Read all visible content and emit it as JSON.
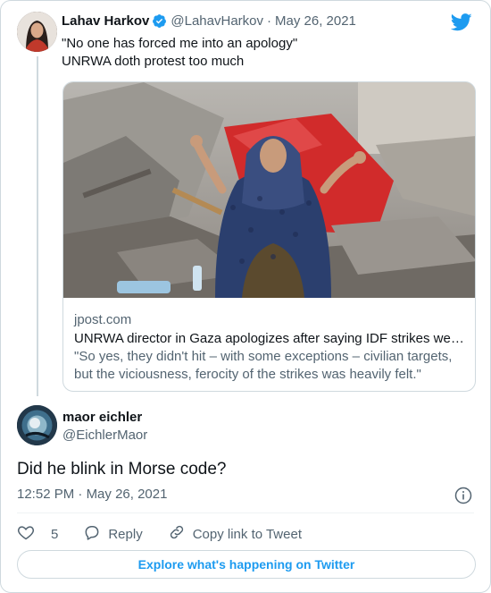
{
  "quoted_tweet": {
    "display_name": "Lahav Harkov",
    "handle": "@LahavHarkov",
    "separator": "·",
    "date": "May 26, 2021",
    "text_line1": "\"No one has forced me into an apology\"",
    "text_line2": "UNRWA doth protest too much"
  },
  "link_card": {
    "domain": "jpost.com",
    "title": "UNRWA director in Gaza apologizes after saying IDF strikes we…",
    "description": "\"So yes, they didn't hit – with some exceptions – civilian targets, but the viciousness, ferocity of the strikes was heavily felt.\""
  },
  "reply": {
    "display_name": "maor eichler",
    "handle": "@EichlerMaor",
    "text": "Did he blink in Morse code?",
    "time": "12:52 PM",
    "separator": "·",
    "date": "May 26, 2021"
  },
  "actions": {
    "like_count": "5",
    "reply_label": "Reply",
    "copy_label": "Copy link to Tweet"
  },
  "explore_label": "Explore what's happening on Twitter",
  "colors": {
    "brand_blue": "#1d9bf0",
    "text_primary": "#0f1419",
    "text_secondary": "#536471",
    "border": "#cfd9de"
  },
  "icons": [
    "verified-badge-icon",
    "twitter-bird-icon",
    "info-icon",
    "heart-icon",
    "reply-icon",
    "link-icon"
  ]
}
